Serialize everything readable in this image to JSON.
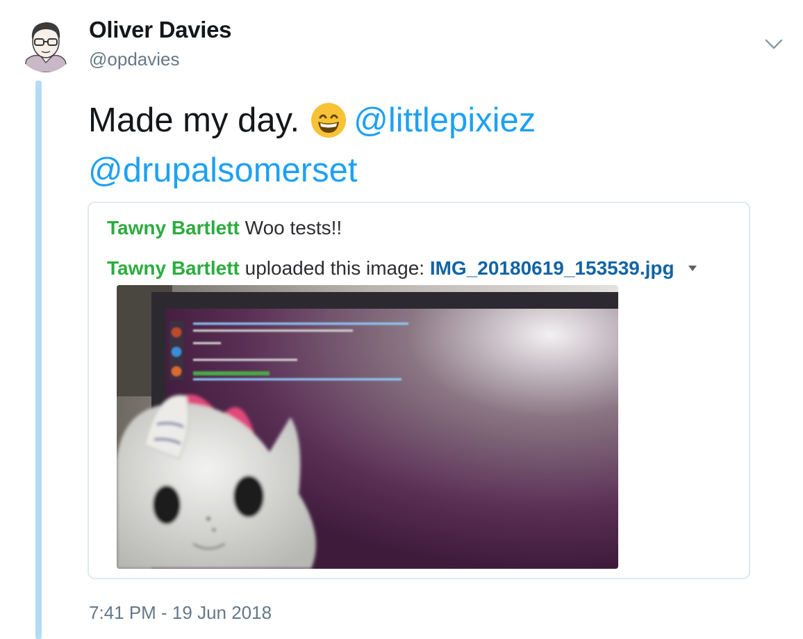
{
  "author": {
    "name": "Oliver Davies",
    "handle": "@opdavies"
  },
  "tweet": {
    "text": "Made my day.",
    "emoji": "grinning-face-with-smiling-eyes",
    "mentions": [
      "@littlepixiez",
      "@drupalsomerset"
    ]
  },
  "embedded_screenshot": {
    "message_1": {
      "user": "Tawny Bartlett",
      "text": "Woo tests!!"
    },
    "message_2": {
      "user": "Tawny Bartlett",
      "text": "uploaded this image:",
      "file": "IMG_20180619_153539.jpg"
    }
  },
  "timestamp": "7:41 PM - 19 Jun 2018",
  "colors": {
    "mention": "#1da1f2",
    "thread_line": "#b3dbf6",
    "slack_user": "#2bac3e",
    "slack_file": "#1264a3",
    "muted": "#657786"
  }
}
